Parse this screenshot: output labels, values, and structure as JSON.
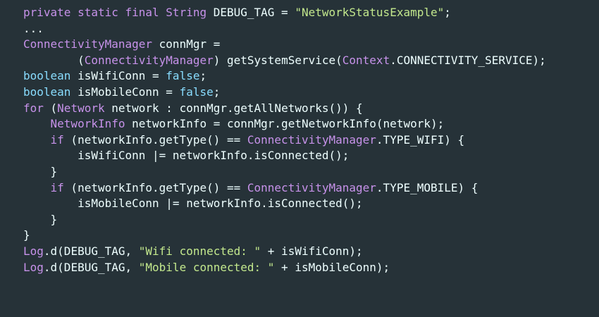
{
  "code_block": {
    "lines": [
      [
        {
          "c": "kw",
          "t": "private static final "
        },
        {
          "c": "ty",
          "t": "String"
        },
        {
          "c": "pl",
          "t": " DEBUG_TAG = "
        },
        {
          "c": "str",
          "t": "\"NetworkStatusExample\""
        },
        {
          "c": "pl",
          "t": ";"
        }
      ],
      [
        {
          "c": "pl",
          "t": "..."
        }
      ],
      [
        {
          "c": "ty",
          "t": "ConnectivityManager"
        },
        {
          "c": "pl",
          "t": " connMgr ="
        }
      ],
      [
        {
          "c": "pl",
          "t": "        ("
        },
        {
          "c": "ty",
          "t": "ConnectivityManager"
        },
        {
          "c": "pl",
          "t": ") getSystemService("
        },
        {
          "c": "ty",
          "t": "Context"
        },
        {
          "c": "pl",
          "t": ".CONNECTIVITY_SERVICE);"
        }
      ],
      [
        {
          "c": "lit",
          "t": "boolean"
        },
        {
          "c": "pl",
          "t": " isWifiConn = "
        },
        {
          "c": "lit",
          "t": "false"
        },
        {
          "c": "pl",
          "t": ";"
        }
      ],
      [
        {
          "c": "lit",
          "t": "boolean"
        },
        {
          "c": "pl",
          "t": " isMobileConn = "
        },
        {
          "c": "lit",
          "t": "false"
        },
        {
          "c": "pl",
          "t": ";"
        }
      ],
      [
        {
          "c": "kw",
          "t": "for"
        },
        {
          "c": "pl",
          "t": " ("
        },
        {
          "c": "ty",
          "t": "Network"
        },
        {
          "c": "pl",
          "t": " network : connMgr.getAllNetworks()) {"
        }
      ],
      [
        {
          "c": "pl",
          "t": "    "
        },
        {
          "c": "ty",
          "t": "NetworkInfo"
        },
        {
          "c": "pl",
          "t": " networkInfo = connMgr.getNetworkInfo(network);"
        }
      ],
      [
        {
          "c": "pl",
          "t": "    "
        },
        {
          "c": "kw",
          "t": "if"
        },
        {
          "c": "pl",
          "t": " (networkInfo.getType() == "
        },
        {
          "c": "ty",
          "t": "ConnectivityManager"
        },
        {
          "c": "pl",
          "t": ".TYPE_WIFI) {"
        }
      ],
      [
        {
          "c": "pl",
          "t": "        isWifiConn |= networkInfo.isConnected();"
        }
      ],
      [
        {
          "c": "pl",
          "t": "    }"
        }
      ],
      [
        {
          "c": "pl",
          "t": "    "
        },
        {
          "c": "kw",
          "t": "if"
        },
        {
          "c": "pl",
          "t": " (networkInfo.getType() == "
        },
        {
          "c": "ty",
          "t": "ConnectivityManager"
        },
        {
          "c": "pl",
          "t": ".TYPE_MOBILE) {"
        }
      ],
      [
        {
          "c": "pl",
          "t": "        isMobileConn |= networkInfo.isConnected();"
        }
      ],
      [
        {
          "c": "pl",
          "t": "    }"
        }
      ],
      [
        {
          "c": "pl",
          "t": "}"
        }
      ],
      [
        {
          "c": "ty",
          "t": "Log"
        },
        {
          "c": "pl",
          "t": ".d(DEBUG_TAG, "
        },
        {
          "c": "str",
          "t": "\"Wifi connected: \""
        },
        {
          "c": "pl",
          "t": " + isWifiConn);"
        }
      ],
      [
        {
          "c": "ty",
          "t": "Log"
        },
        {
          "c": "pl",
          "t": ".d(DEBUG_TAG, "
        },
        {
          "c": "str",
          "t": "\"Mobile connected: \""
        },
        {
          "c": "pl",
          "t": " + isMobileConn);"
        }
      ]
    ]
  },
  "colors": {
    "background": "#263238",
    "plain": "#eeffff",
    "keyword": "#c792ea",
    "type": "#c792ea",
    "string": "#c3e88d",
    "literal": "#89ddff"
  }
}
